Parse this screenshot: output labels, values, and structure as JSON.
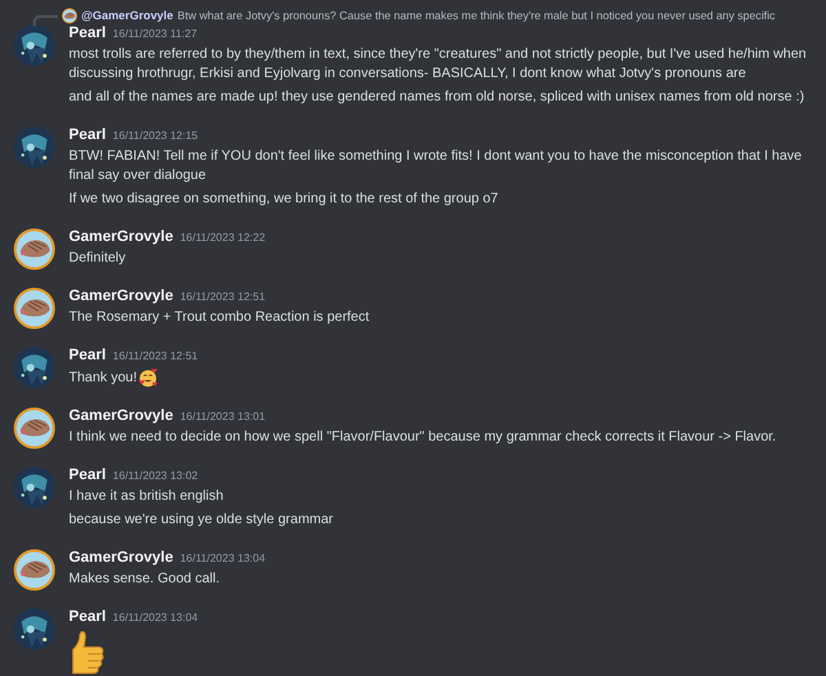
{
  "messages": [
    {
      "author": "Pearl",
      "avatar": {
        "kind": "pearl"
      },
      "time": "16/11/2023 11:27",
      "reply": {
        "avatar": {
          "kind": "gamer"
        },
        "mention": "@GamerGrovyle",
        "text": "Btw what are Jotvy's pronouns? Cause the name makes me think they're male but I noticed you never used any specific"
      },
      "lines": [
        {
          "kind": "text",
          "text": "most trolls are referred to by they/them in text, since they're \"creatures\" and not strictly people, but I've used he/him when discussing hrothrugr, Erkisi and Eyjolvarg in conversations- BASICALLY, I dont know what Jotvy's pronouns are"
        },
        {
          "kind": "text",
          "text": "and all of the names are made up! they use gendered names from old norse, spliced with unisex names from old norse :)"
        }
      ]
    },
    {
      "author": "Pearl",
      "avatar": {
        "kind": "pearl"
      },
      "time": "16/11/2023 12:15",
      "lines": [
        {
          "kind": "text",
          "text": "BTW! FABIAN! Tell me if YOU don't feel like something I wrote fits! I dont want you to have the misconception that I have final say over dialogue"
        },
        {
          "kind": "text",
          "text": "If we two disagree on something, we bring it to the rest of the group o7"
        }
      ]
    },
    {
      "author": "GamerGrovyle",
      "avatar": {
        "kind": "gamer"
      },
      "time": "16/11/2023 12:22",
      "lines": [
        {
          "kind": "text",
          "text": "Definitely"
        }
      ]
    },
    {
      "author": "GamerGrovyle",
      "avatar": {
        "kind": "gamer"
      },
      "time": "16/11/2023 12:51",
      "lines": [
        {
          "kind": "text",
          "text": "The Rosemary + Trout combo Reaction is perfect"
        }
      ]
    },
    {
      "author": "Pearl",
      "avatar": {
        "kind": "pearl"
      },
      "time": "16/11/2023 12:51",
      "lines": [
        {
          "kind": "text_with_hearts_face",
          "text": "Thank you!"
        }
      ]
    },
    {
      "author": "GamerGrovyle",
      "avatar": {
        "kind": "gamer"
      },
      "time": "16/11/2023 13:01",
      "lines": [
        {
          "kind": "text",
          "text": "I think we need to decide on how we spell \"Flavor/Flavour\" because my grammar check corrects it Flavour -> Flavor."
        }
      ]
    },
    {
      "author": "Pearl",
      "avatar": {
        "kind": "pearl"
      },
      "time": "16/11/2023 13:02",
      "lines": [
        {
          "kind": "text",
          "text": "I have it as british english"
        },
        {
          "kind": "text",
          "text": "because we're using ye olde style grammar"
        }
      ]
    },
    {
      "author": "GamerGrovyle",
      "avatar": {
        "kind": "gamer"
      },
      "time": "16/11/2023 13:04",
      "lines": [
        {
          "kind": "text",
          "text": "Makes sense. Good call."
        }
      ]
    },
    {
      "author": "Pearl",
      "avatar": {
        "kind": "pearl"
      },
      "time": "16/11/2023 13:04",
      "lines": [
        {
          "kind": "thumbs_up"
        }
      ]
    }
  ]
}
